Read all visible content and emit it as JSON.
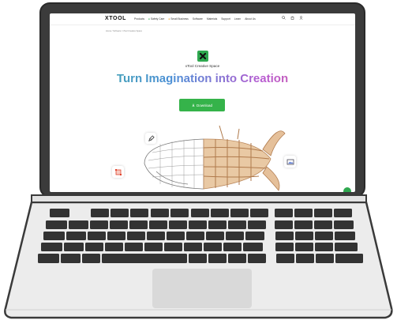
{
  "screen": {
    "logo": "XTOOL",
    "nav_items": [
      "Products",
      "Safety Care",
      "Small Business",
      "Software",
      "Materials",
      "Support",
      "Learn",
      "About Us"
    ],
    "breadcrumb": "Home / Software / xTool Creative Space",
    "app_name": "xTool Creative Space",
    "headline": "Turn Imagination into Creation",
    "download_label": "Download"
  },
  "colors": {
    "accent_green": "#35b34a",
    "headline_gradient": [
      "#3fb39b",
      "#4b8fd6",
      "#b95bd1",
      "#e06a8a"
    ],
    "laptop_body": "#e9e9e9",
    "bezel": "#3a3a3a",
    "keys": "#333333"
  },
  "icons": [
    "search-icon",
    "cart-icon",
    "user-icon",
    "download-icon",
    "pen-icon",
    "crop-icon",
    "image-icon",
    "chat-icon"
  ]
}
